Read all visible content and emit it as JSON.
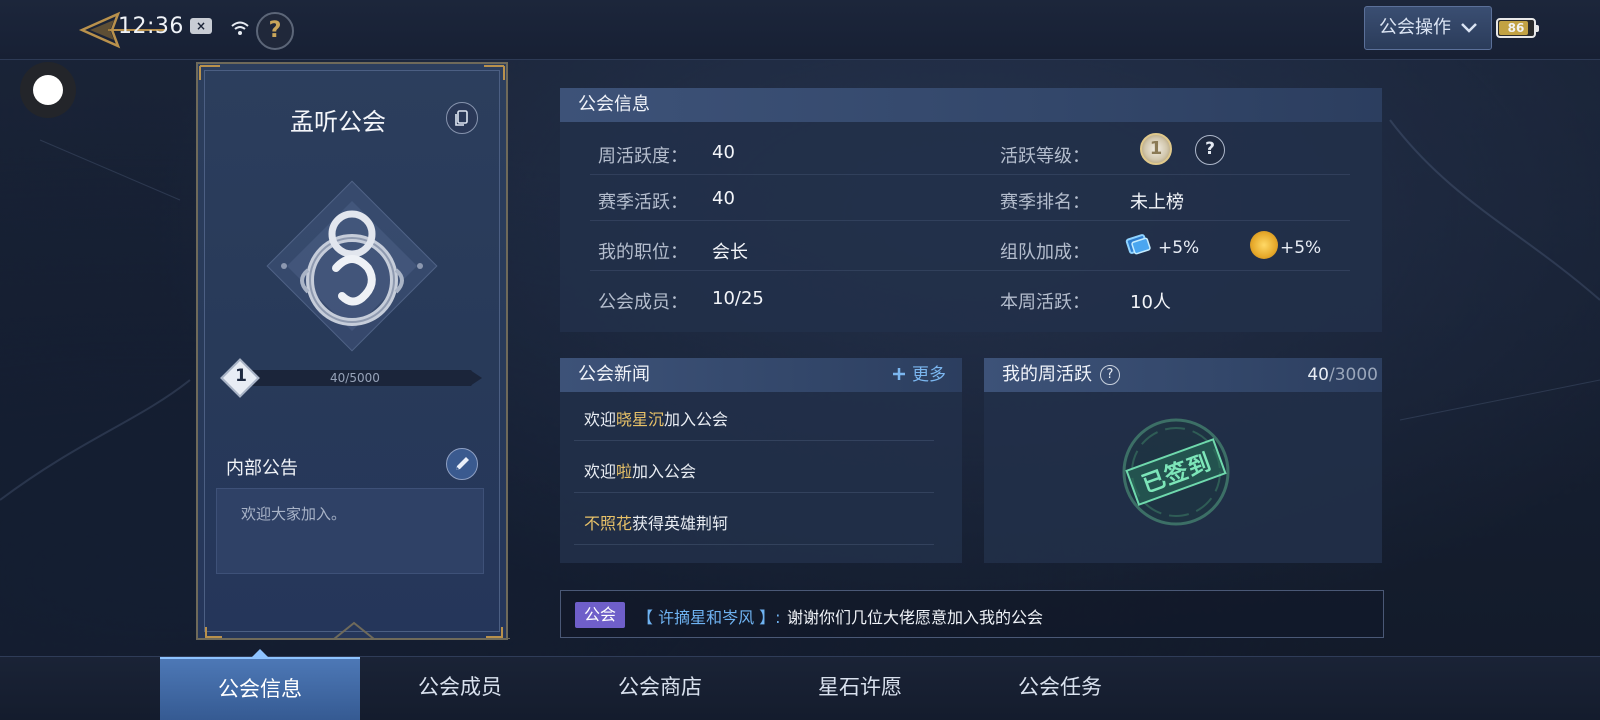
{
  "status": {
    "time": "12:36",
    "battery": "86",
    "battery_level": 0.86
  },
  "header": {
    "guild_ops_label": "公会操作"
  },
  "banner": {
    "guild_name": "孟听公会",
    "level": "1",
    "progress_text": "40/5000",
    "progress_fraction": 0.008,
    "notice_title": "内部公告",
    "notice_text": "欢迎大家加入。"
  },
  "info": {
    "title": "公会信息",
    "rows": [
      {
        "label": "周活跃度：",
        "value": "40"
      },
      {
        "label": "赛季活跃：",
        "value": "40"
      },
      {
        "label": "我的职位：",
        "value": "会长"
      },
      {
        "label": "公会成员：",
        "value": "10/25"
      }
    ],
    "right_rows": [
      {
        "label": "活跃等级：",
        "medal": "1"
      },
      {
        "label": "赛季排名：",
        "value": "未上榜"
      },
      {
        "label": "组队加成：",
        "bonus1": "+5%",
        "bonus2": "+5%"
      },
      {
        "label": "本周活跃：",
        "value": "10人"
      }
    ]
  },
  "news": {
    "title": "公会新闻",
    "more_label": "更多",
    "items": [
      {
        "pre": "欢迎",
        "highlight": "晓星沉",
        "post": "加入公会"
      },
      {
        "pre": "欢迎",
        "highlight": "啦",
        "post": "加入公会"
      },
      {
        "pre": "",
        "highlight": "不照花",
        "post": "获得英雄荆轲"
      }
    ]
  },
  "weekly": {
    "title": "我的周活跃",
    "current": "40",
    "total": "/3000",
    "stamp": "已签到"
  },
  "chat": {
    "tag": "公会",
    "name": "【 许摘星和岑风 】:",
    "message": "谢谢你们几位大佬愿意加入我的公会"
  },
  "nav": {
    "tabs": [
      "公会信息",
      "公会成员",
      "公会商店",
      "星石许愿",
      "公会任务"
    ],
    "active": 0
  },
  "icons": {
    "back": "back-arrow-icon",
    "help": "help-icon",
    "copy": "copy-icon",
    "edit": "edit-pencil-icon",
    "chevron": "chevron-down-icon",
    "emblem": "guild-emblem-icon"
  }
}
